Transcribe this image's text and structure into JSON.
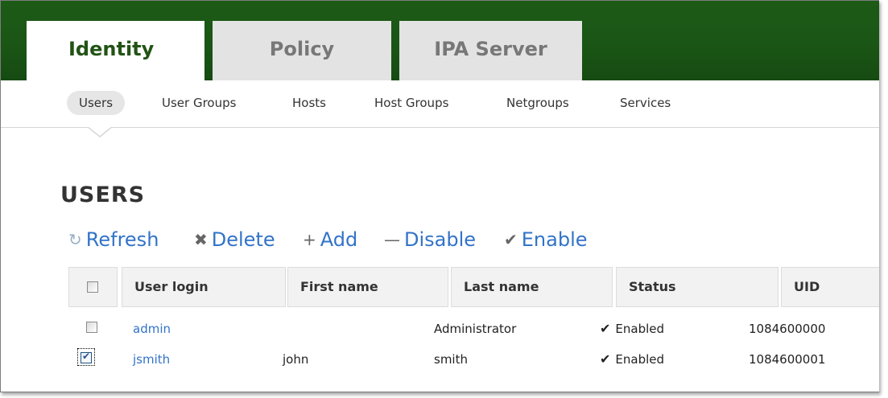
{
  "main_tabs": [
    {
      "label": "Identity",
      "active": true
    },
    {
      "label": "Policy",
      "active": false
    },
    {
      "label": "IPA Server",
      "active": false
    }
  ],
  "sub_nav": [
    {
      "label": "Users",
      "active": true
    },
    {
      "label": "User Groups",
      "active": false
    },
    {
      "label": "Hosts",
      "active": false
    },
    {
      "label": "Host Groups",
      "active": false
    },
    {
      "label": "Netgroups",
      "active": false
    },
    {
      "label": "Services",
      "active": false
    }
  ],
  "page": {
    "title": "USERS"
  },
  "actions": [
    {
      "label": "Refresh",
      "icon": "refresh-icon"
    },
    {
      "label": "Delete",
      "icon": "delete-icon"
    },
    {
      "label": "Add",
      "icon": "add-icon"
    },
    {
      "label": "Disable",
      "icon": "disable-icon"
    },
    {
      "label": "Enable",
      "icon": "enable-icon"
    }
  ],
  "table": {
    "columns": [
      "User login",
      "First name",
      "Last name",
      "Status",
      "UID"
    ],
    "rows": [
      {
        "selected": false,
        "login": "admin",
        "first_name": "",
        "last_name": "Administrator",
        "status": "Enabled",
        "uid": "1084600000"
      },
      {
        "selected": true,
        "login": "jsmith",
        "first_name": "john",
        "last_name": "smith",
        "status": "Enabled",
        "uid": "1084600001"
      }
    ]
  },
  "colors": {
    "header_green": "#1d5a16",
    "active_tab_text": "#225314",
    "link_blue": "#3273c8"
  }
}
